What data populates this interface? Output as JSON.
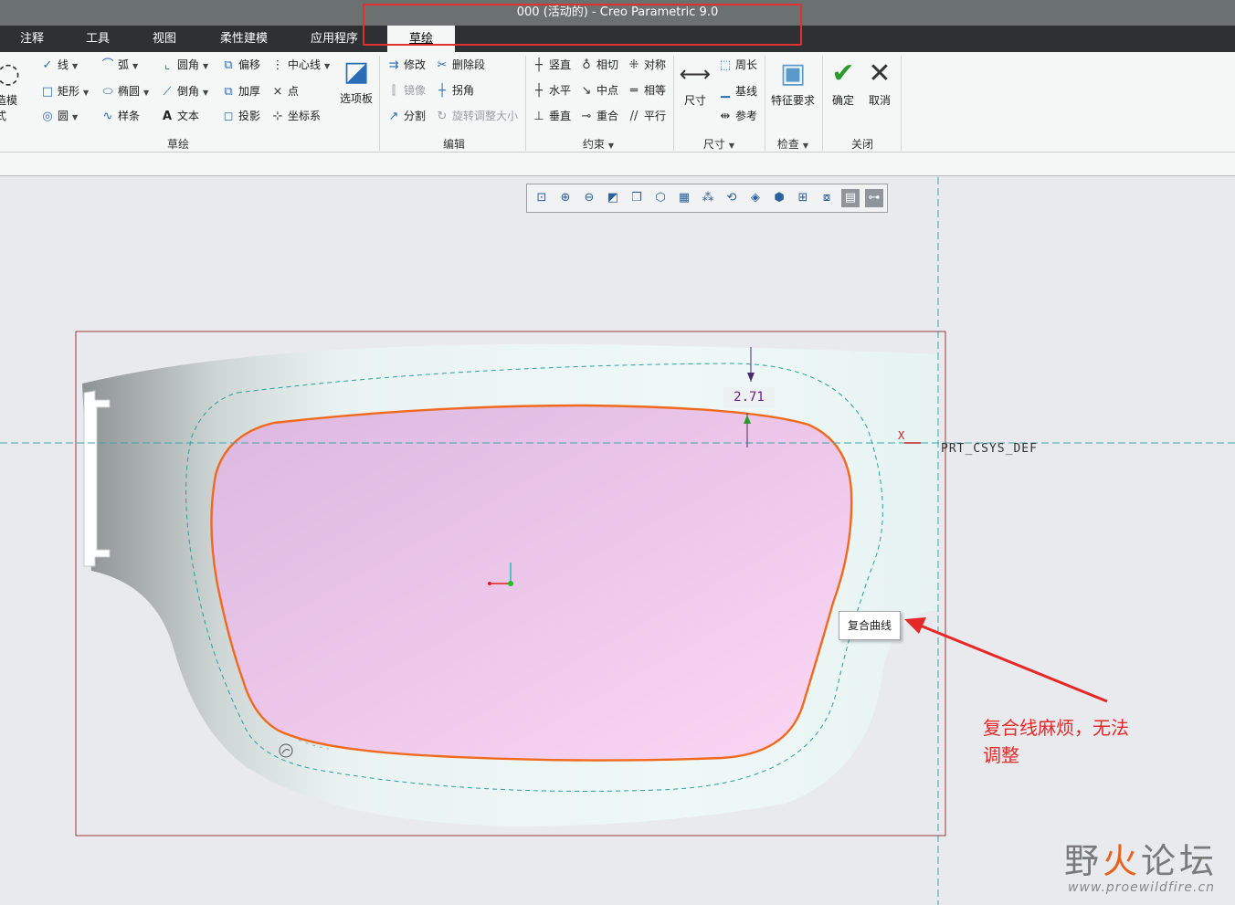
{
  "window": {
    "title": "000 (活动的) - Creo Parametric 9.0"
  },
  "tabs": [
    {
      "label": "注释"
    },
    {
      "label": "工具"
    },
    {
      "label": "视图"
    },
    {
      "label": "柔性建模"
    },
    {
      "label": "应用程序"
    },
    {
      "label": "草绘",
      "active": true
    }
  ],
  "ribbon": {
    "sketch_group": {
      "label": "草绘",
      "construction_mode": "构造模式",
      "line": "线",
      "arc": "弧",
      "fillet": "圆角",
      "offset": "偏移",
      "centerline": "中心线",
      "rectangle": "矩形",
      "ellipse": "椭圆",
      "chamfer": "倒角",
      "thicken": "加厚",
      "point": "点",
      "circle": "圆",
      "spline": "样条",
      "text": "文本",
      "project": "投影",
      "coordsys": "坐标系",
      "palette": "选项板"
    },
    "edit_group": {
      "label": "编辑",
      "modify": "修改",
      "delete_segment": "删除段",
      "mirror": "镜像",
      "corner": "拐角",
      "divide": "分割",
      "rotate_resize": "旋转调整大小"
    },
    "constrain_group": {
      "label": "约束",
      "vertical": "竖直",
      "tangent": "相切",
      "symmetric": "对称",
      "horizontal": "水平",
      "midpoint": "中点",
      "equal": "相等",
      "perpendicular": "垂直",
      "coincident": "重合",
      "parallel": "平行"
    },
    "dimension_group": {
      "label": "尺寸",
      "dimension": "尺寸",
      "perimeter": "周长",
      "baseline": "基线",
      "reference": "参考"
    },
    "inspect_group": {
      "label": "检查",
      "feature_requirements": "特征要求"
    },
    "close_group": {
      "label": "关闭",
      "ok": "确定",
      "cancel": "取消"
    }
  },
  "graphics_toolbar": {
    "icons": [
      "refit-icon",
      "zoom-in-icon",
      "zoom-out-icon",
      "repaint-icon",
      "view-manager-icon",
      "saved-orientations-icon",
      "display-style-icon",
      "datum-display-icon",
      "spin-center-icon",
      "annotation-display-icon",
      "sketch-view-icon",
      "sketcher-display-icon",
      "constraint-display-icon",
      "vertex-display-icon",
      "dimension-display-icon"
    ]
  },
  "canvas": {
    "dimension_value": "2.71",
    "axis_x_label": "X",
    "csys_label": "PRT_CSYS_DEF",
    "tooltip": "复合曲线"
  },
  "annotation": {
    "text_line1": "复合线麻烦，无法",
    "text_line2": "调整",
    "color": "#e62828"
  },
  "watermark": {
    "main_a": "野",
    "main_fire": "火",
    "main_b": "论坛",
    "url": "www.proewildfire.cn"
  },
  "colors": {
    "curve": "#f06a1e",
    "dashed": "#2aa0a0",
    "lens_fill_top": "#dcb8e0",
    "lens_fill_bottom": "#fcd6f4"
  }
}
